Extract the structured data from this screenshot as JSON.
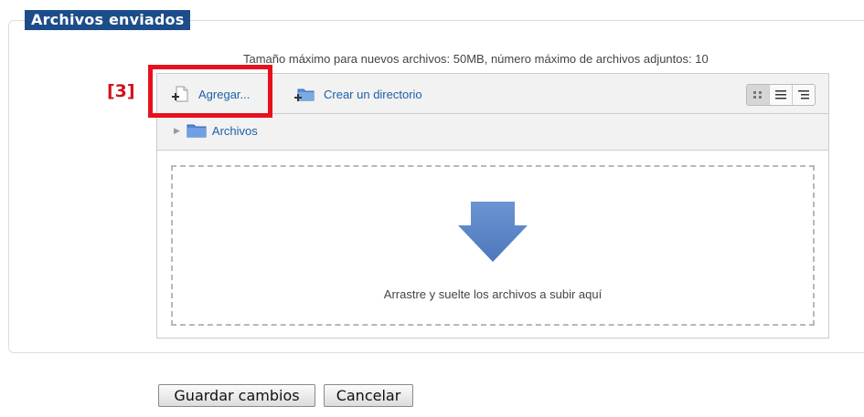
{
  "section": {
    "legend": "Archivos enviados",
    "limits_text": "Tamaño máximo para nuevos archivos: 50MB, número máximo de archivos adjuntos: 10"
  },
  "step_marker": "[3]",
  "toolbar": {
    "add_label": "Agregar...",
    "mkdir_label": "Crear un directorio",
    "view_modes": [
      "icons-view-icon",
      "list-view-icon",
      "tree-view-icon"
    ],
    "active_view": "icons"
  },
  "path": {
    "folder": "Archivos"
  },
  "dropzone": {
    "text": "Arrastre y suelte los archivos a subir aquí"
  },
  "footer": {
    "save_label": "Guardar cambios",
    "cancel_label": "Cancelar"
  },
  "colors": {
    "legend_bg": "#1c4d8a",
    "link": "#1e5fa8",
    "highlight": "#e8101e",
    "drop_arrow": "#5b85c6"
  }
}
